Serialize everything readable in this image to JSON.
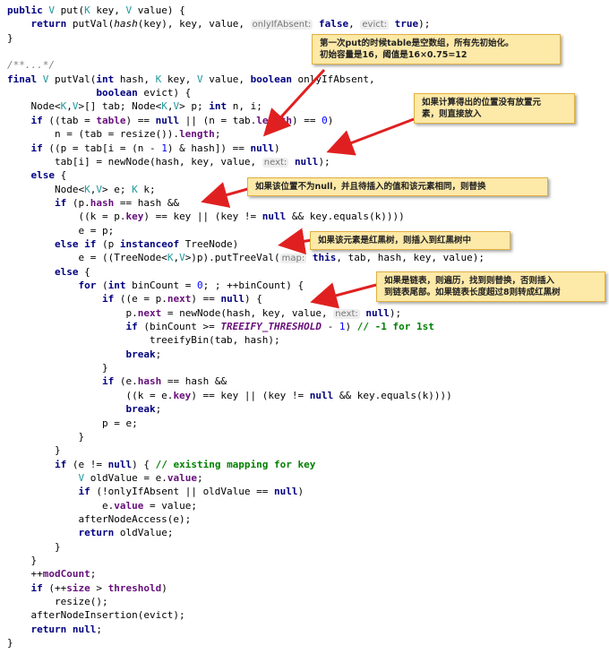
{
  "code_lines": [
    {
      "segments": [
        {
          "c": "kw",
          "t": "public"
        },
        {
          "c": "",
          "t": " "
        },
        {
          "c": "type",
          "t": "V"
        },
        {
          "c": "",
          "t": " put("
        },
        {
          "c": "type",
          "t": "K"
        },
        {
          "c": "",
          "t": " key, "
        },
        {
          "c": "type",
          "t": "V"
        },
        {
          "c": "",
          "t": " value) {"
        }
      ]
    },
    {
      "segments": [
        {
          "c": "",
          "t": "    "
        },
        {
          "c": "kw",
          "t": "return"
        },
        {
          "c": "",
          "t": " putVal("
        },
        {
          "c": "italic",
          "t": "hash"
        },
        {
          "c": "",
          "t": "(key), key, value, "
        },
        {
          "c": "hint",
          "t": "onlyIfAbsent:"
        },
        {
          "c": "",
          "t": " "
        },
        {
          "c": "kw",
          "t": "false"
        },
        {
          "c": "",
          "t": ", "
        },
        {
          "c": "hint",
          "t": "evict:"
        },
        {
          "c": "",
          "t": " "
        },
        {
          "c": "kw",
          "t": "true"
        },
        {
          "c": "",
          "t": ");"
        }
      ]
    },
    {
      "segments": [
        {
          "c": "",
          "t": "}"
        }
      ]
    },
    {
      "segments": [
        {
          "c": "",
          "t": ""
        }
      ]
    },
    {
      "segments": [
        {
          "c": "comment",
          "t": "/**...*/"
        }
      ]
    },
    {
      "segments": [
        {
          "c": "kw",
          "t": "final"
        },
        {
          "c": "",
          "t": " "
        },
        {
          "c": "type",
          "t": "V"
        },
        {
          "c": "",
          "t": " putVal("
        },
        {
          "c": "kw",
          "t": "int"
        },
        {
          "c": "",
          "t": " hash, "
        },
        {
          "c": "type",
          "t": "K"
        },
        {
          "c": "",
          "t": " key, "
        },
        {
          "c": "type",
          "t": "V"
        },
        {
          "c": "",
          "t": " value, "
        },
        {
          "c": "kw",
          "t": "boolean"
        },
        {
          "c": "",
          "t": " onlyIfAbsent,"
        }
      ]
    },
    {
      "segments": [
        {
          "c": "",
          "t": "               "
        },
        {
          "c": "kw",
          "t": "boolean"
        },
        {
          "c": "",
          "t": " evict) {"
        }
      ]
    },
    {
      "segments": [
        {
          "c": "",
          "t": "    Node<"
        },
        {
          "c": "type",
          "t": "K"
        },
        {
          "c": "",
          "t": ","
        },
        {
          "c": "type",
          "t": "V"
        },
        {
          "c": "",
          "t": ">[] tab; Node<"
        },
        {
          "c": "type",
          "t": "K"
        },
        {
          "c": "",
          "t": ","
        },
        {
          "c": "type",
          "t": "V"
        },
        {
          "c": "",
          "t": "> p; "
        },
        {
          "c": "kw",
          "t": "int"
        },
        {
          "c": "",
          "t": " n, i;"
        }
      ]
    },
    {
      "segments": [
        {
          "c": "",
          "t": "    "
        },
        {
          "c": "kw",
          "t": "if"
        },
        {
          "c": "",
          "t": " ((tab = "
        },
        {
          "c": "field",
          "t": "table"
        },
        {
          "c": "",
          "t": ") == "
        },
        {
          "c": "kw",
          "t": "null"
        },
        {
          "c": "",
          "t": " || (n = tab."
        },
        {
          "c": "field",
          "t": "length"
        },
        {
          "c": "",
          "t": ") == "
        },
        {
          "c": "num",
          "t": "0"
        },
        {
          "c": "",
          "t": ")"
        }
      ]
    },
    {
      "segments": [
        {
          "c": "",
          "t": "        n = (tab = resize())."
        },
        {
          "c": "field",
          "t": "length"
        },
        {
          "c": "",
          "t": ";"
        }
      ]
    },
    {
      "segments": [
        {
          "c": "",
          "t": "    "
        },
        {
          "c": "kw",
          "t": "if"
        },
        {
          "c": "",
          "t": " ((p = tab[i = (n - "
        },
        {
          "c": "num",
          "t": "1"
        },
        {
          "c": "",
          "t": ") & hash]) == "
        },
        {
          "c": "kw",
          "t": "null"
        },
        {
          "c": "",
          "t": ")"
        }
      ]
    },
    {
      "segments": [
        {
          "c": "",
          "t": "        tab[i] = newNode(hash, key, value, "
        },
        {
          "c": "hint",
          "t": "next:"
        },
        {
          "c": "",
          "t": " "
        },
        {
          "c": "kw",
          "t": "null"
        },
        {
          "c": "",
          "t": ");"
        }
      ]
    },
    {
      "segments": [
        {
          "c": "",
          "t": "    "
        },
        {
          "c": "kw",
          "t": "else"
        },
        {
          "c": "",
          "t": " {"
        }
      ]
    },
    {
      "segments": [
        {
          "c": "",
          "t": "        Node<"
        },
        {
          "c": "type",
          "t": "K"
        },
        {
          "c": "",
          "t": ","
        },
        {
          "c": "type",
          "t": "V"
        },
        {
          "c": "",
          "t": "> e; "
        },
        {
          "c": "type",
          "t": "K"
        },
        {
          "c": "",
          "t": " k;"
        }
      ]
    },
    {
      "segments": [
        {
          "c": "",
          "t": "        "
        },
        {
          "c": "kw",
          "t": "if"
        },
        {
          "c": "",
          "t": " (p."
        },
        {
          "c": "field",
          "t": "hash"
        },
        {
          "c": "",
          "t": " == hash &&"
        }
      ]
    },
    {
      "segments": [
        {
          "c": "",
          "t": "            ((k = p."
        },
        {
          "c": "field",
          "t": "key"
        },
        {
          "c": "",
          "t": ") == key || (key != "
        },
        {
          "c": "kw",
          "t": "null"
        },
        {
          "c": "",
          "t": " && key.equals(k))))"
        }
      ]
    },
    {
      "segments": [
        {
          "c": "",
          "t": "            e = p;"
        }
      ]
    },
    {
      "segments": [
        {
          "c": "",
          "t": "        "
        },
        {
          "c": "kw",
          "t": "else if"
        },
        {
          "c": "",
          "t": " (p "
        },
        {
          "c": "kw",
          "t": "instanceof"
        },
        {
          "c": "",
          "t": " TreeNode)"
        }
      ]
    },
    {
      "segments": [
        {
          "c": "",
          "t": "            e = ((TreeNode<"
        },
        {
          "c": "type",
          "t": "K"
        },
        {
          "c": "",
          "t": ","
        },
        {
          "c": "type",
          "t": "V"
        },
        {
          "c": "",
          "t": ">)p).putTreeVal("
        },
        {
          "c": "hint",
          "t": "map:"
        },
        {
          "c": "",
          "t": " "
        },
        {
          "c": "kw",
          "t": "this"
        },
        {
          "c": "",
          "t": ", tab, hash, key, value);"
        }
      ]
    },
    {
      "segments": [
        {
          "c": "",
          "t": "        "
        },
        {
          "c": "kw",
          "t": "else"
        },
        {
          "c": "",
          "t": " {"
        }
      ]
    },
    {
      "segments": [
        {
          "c": "",
          "t": "            "
        },
        {
          "c": "kw",
          "t": "for"
        },
        {
          "c": "",
          "t": " ("
        },
        {
          "c": "kw",
          "t": "int"
        },
        {
          "c": "",
          "t": " binCount = "
        },
        {
          "c": "num",
          "t": "0"
        },
        {
          "c": "",
          "t": "; ; ++binCount) {"
        }
      ]
    },
    {
      "segments": [
        {
          "c": "",
          "t": "                "
        },
        {
          "c": "kw",
          "t": "if"
        },
        {
          "c": "",
          "t": " ((e = p."
        },
        {
          "c": "field",
          "t": "next"
        },
        {
          "c": "",
          "t": ") == "
        },
        {
          "c": "kw",
          "t": "null"
        },
        {
          "c": "",
          "t": ") {"
        }
      ]
    },
    {
      "segments": [
        {
          "c": "",
          "t": "                    p."
        },
        {
          "c": "field",
          "t": "next"
        },
        {
          "c": "",
          "t": " = newNode(hash, key, value, "
        },
        {
          "c": "hint",
          "t": "next:"
        },
        {
          "c": "",
          "t": " "
        },
        {
          "c": "kw",
          "t": "null"
        },
        {
          "c": "",
          "t": ");"
        }
      ]
    },
    {
      "segments": [
        {
          "c": "",
          "t": "                    "
        },
        {
          "c": "kw",
          "t": "if"
        },
        {
          "c": "",
          "t": " (binCount >= "
        },
        {
          "c": "const",
          "t": "TREEIFY_THRESHOLD"
        },
        {
          "c": "",
          "t": " - "
        },
        {
          "c": "num",
          "t": "1"
        },
        {
          "c": "",
          "t": ") "
        },
        {
          "c": "green",
          "t": "// -1 for 1st"
        }
      ]
    },
    {
      "segments": [
        {
          "c": "",
          "t": "                        treeifyBin(tab, hash);"
        }
      ]
    },
    {
      "segments": [
        {
          "c": "",
          "t": "                    "
        },
        {
          "c": "kw",
          "t": "break"
        },
        {
          "c": "",
          "t": ";"
        }
      ]
    },
    {
      "segments": [
        {
          "c": "",
          "t": "                }"
        }
      ]
    },
    {
      "segments": [
        {
          "c": "",
          "t": "                "
        },
        {
          "c": "kw",
          "t": "if"
        },
        {
          "c": "",
          "t": " (e."
        },
        {
          "c": "field",
          "t": "hash"
        },
        {
          "c": "",
          "t": " == hash &&"
        }
      ]
    },
    {
      "segments": [
        {
          "c": "",
          "t": "                    ((k = e."
        },
        {
          "c": "field",
          "t": "key"
        },
        {
          "c": "",
          "t": ") == key || (key != "
        },
        {
          "c": "kw",
          "t": "null"
        },
        {
          "c": "",
          "t": " && key.equals(k))))"
        }
      ]
    },
    {
      "segments": [
        {
          "c": "",
          "t": "                    "
        },
        {
          "c": "kw",
          "t": "break"
        },
        {
          "c": "",
          "t": ";"
        }
      ]
    },
    {
      "segments": [
        {
          "c": "",
          "t": "                p = e;"
        }
      ]
    },
    {
      "segments": [
        {
          "c": "",
          "t": "            }"
        }
      ]
    },
    {
      "segments": [
        {
          "c": "",
          "t": "        }"
        }
      ]
    },
    {
      "segments": [
        {
          "c": "",
          "t": "        "
        },
        {
          "c": "kw",
          "t": "if"
        },
        {
          "c": "",
          "t": " (e != "
        },
        {
          "c": "kw",
          "t": "null"
        },
        {
          "c": "",
          "t": ") { "
        },
        {
          "c": "green",
          "t": "// existing mapping for key"
        }
      ]
    },
    {
      "segments": [
        {
          "c": "",
          "t": "            "
        },
        {
          "c": "type",
          "t": "V"
        },
        {
          "c": "",
          "t": " oldValue = e."
        },
        {
          "c": "field",
          "t": "value"
        },
        {
          "c": "",
          "t": ";"
        }
      ]
    },
    {
      "segments": [
        {
          "c": "",
          "t": "            "
        },
        {
          "c": "kw",
          "t": "if"
        },
        {
          "c": "",
          "t": " (!onlyIfAbsent || oldValue == "
        },
        {
          "c": "kw",
          "t": "null"
        },
        {
          "c": "",
          "t": ")"
        }
      ]
    },
    {
      "segments": [
        {
          "c": "",
          "t": "                e."
        },
        {
          "c": "field",
          "t": "value"
        },
        {
          "c": "",
          "t": " = value;"
        }
      ]
    },
    {
      "segments": [
        {
          "c": "",
          "t": "            afterNodeAccess(e);"
        }
      ]
    },
    {
      "segments": [
        {
          "c": "",
          "t": "            "
        },
        {
          "c": "kw",
          "t": "return"
        },
        {
          "c": "",
          "t": " oldValue;"
        }
      ]
    },
    {
      "segments": [
        {
          "c": "",
          "t": "        }"
        }
      ]
    },
    {
      "segments": [
        {
          "c": "",
          "t": "    }"
        }
      ]
    },
    {
      "segments": [
        {
          "c": "",
          "t": "    ++"
        },
        {
          "c": "field",
          "t": "modCount"
        },
        {
          "c": "",
          "t": ";"
        }
      ]
    },
    {
      "segments": [
        {
          "c": "",
          "t": "    "
        },
        {
          "c": "kw",
          "t": "if"
        },
        {
          "c": "",
          "t": " (++"
        },
        {
          "c": "field",
          "t": "size"
        },
        {
          "c": "",
          "t": " > "
        },
        {
          "c": "field",
          "t": "threshold"
        },
        {
          "c": "",
          "t": ")"
        }
      ]
    },
    {
      "segments": [
        {
          "c": "",
          "t": "        resize();"
        }
      ]
    },
    {
      "segments": [
        {
          "c": "",
          "t": "    afterNodeInsertion(evict);"
        }
      ]
    },
    {
      "segments": [
        {
          "c": "",
          "t": "    "
        },
        {
          "c": "kw",
          "t": "return"
        },
        {
          "c": "",
          "t": " "
        },
        {
          "c": "kw",
          "t": "null"
        },
        {
          "c": "",
          "t": ";"
        }
      ]
    },
    {
      "segments": [
        {
          "c": "",
          "t": "}"
        }
      ]
    }
  ],
  "annotations": [
    {
      "id": "note-1",
      "lines": [
        "第一次put的时候table是空数组，所有先初始化。",
        "初始容量是16，阈值是16×0.75=12"
      ]
    },
    {
      "id": "note-2",
      "lines": [
        "如果计算得出的位置没有放置元",
        "素，则直接放入"
      ]
    },
    {
      "id": "note-3",
      "lines": [
        "如果该位置不为null，并且待插入的值和该元素相同，则替换"
      ]
    },
    {
      "id": "note-4",
      "lines": [
        "如果该元素是红黑树，则插入到红黑树中"
      ]
    },
    {
      "id": "note-5",
      "lines": [
        "如果是链表，则遍历，找到则替换，否则插入",
        "到链表尾部。如果链表长度超过8则转成红黑树"
      ]
    }
  ],
  "colors": {
    "background": "#ffffff",
    "keyword": "#000080",
    "field": "#660e7a",
    "comment": "#808080",
    "line_comment": "#008000",
    "type_param": "#20999d",
    "number": "#0000ff",
    "note_bg": "#fde9a8",
    "note_border": "#e0b040",
    "arrow": "#e02020"
  }
}
